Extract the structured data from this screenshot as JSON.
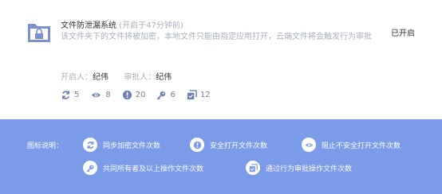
{
  "system": {
    "title": "文件防泄漏系统",
    "opened_time": "(开启于47分钟前)",
    "description": "该文件夹下的文件将被加密，本地文件只能由指定应用打开，云端文件将会触发行为审批",
    "state": "已开启"
  },
  "people": {
    "opener_label": "开启人：",
    "opener": "纪伟",
    "approver_label": "审批人：",
    "approver": "纪伟"
  },
  "stats": {
    "sync": "5",
    "view": "8",
    "alert": "20",
    "share": "6",
    "approve": "12"
  },
  "legend": {
    "title": "图标说明：",
    "sync": "同步加密文件次数",
    "safe_open": "安全打开文件次数",
    "block": "阻止不安全打开文件次数",
    "share": "共同所有者及以上操作文件次数",
    "approve": "通过行为审批操作文件次数"
  },
  "colors": {
    "accent": "#7b9ae8",
    "icon": "#6f7fb0",
    "muted": "#aab0bd"
  }
}
